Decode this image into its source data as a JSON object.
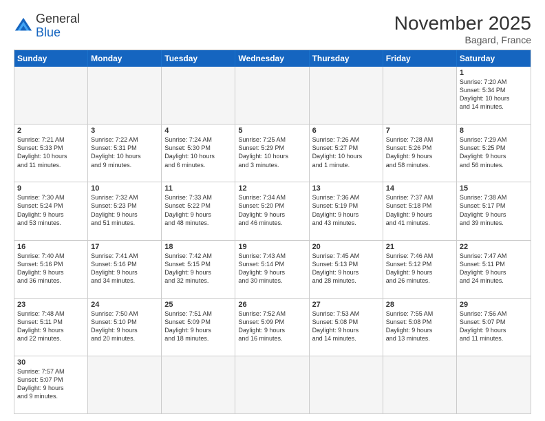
{
  "header": {
    "logo_general": "General",
    "logo_blue": "Blue",
    "month_year": "November 2025",
    "location": "Bagard, France"
  },
  "days": [
    "Sunday",
    "Monday",
    "Tuesday",
    "Wednesday",
    "Thursday",
    "Friday",
    "Saturday"
  ],
  "rows": [
    [
      {
        "day": "",
        "info": "",
        "empty": true
      },
      {
        "day": "",
        "info": "",
        "empty": true
      },
      {
        "day": "",
        "info": "",
        "empty": true
      },
      {
        "day": "",
        "info": "",
        "empty": true
      },
      {
        "day": "",
        "info": "",
        "empty": true
      },
      {
        "day": "",
        "info": "",
        "empty": true
      },
      {
        "day": "1",
        "info": "Sunrise: 7:20 AM\nSunset: 5:34 PM\nDaylight: 10 hours\nand 14 minutes.",
        "empty": false
      }
    ],
    [
      {
        "day": "2",
        "info": "Sunrise: 7:21 AM\nSunset: 5:33 PM\nDaylight: 10 hours\nand 11 minutes.",
        "empty": false
      },
      {
        "day": "3",
        "info": "Sunrise: 7:22 AM\nSunset: 5:31 PM\nDaylight: 10 hours\nand 9 minutes.",
        "empty": false
      },
      {
        "day": "4",
        "info": "Sunrise: 7:24 AM\nSunset: 5:30 PM\nDaylight: 10 hours\nand 6 minutes.",
        "empty": false
      },
      {
        "day": "5",
        "info": "Sunrise: 7:25 AM\nSunset: 5:29 PM\nDaylight: 10 hours\nand 3 minutes.",
        "empty": false
      },
      {
        "day": "6",
        "info": "Sunrise: 7:26 AM\nSunset: 5:27 PM\nDaylight: 10 hours\nand 1 minute.",
        "empty": false
      },
      {
        "day": "7",
        "info": "Sunrise: 7:28 AM\nSunset: 5:26 PM\nDaylight: 9 hours\nand 58 minutes.",
        "empty": false
      },
      {
        "day": "8",
        "info": "Sunrise: 7:29 AM\nSunset: 5:25 PM\nDaylight: 9 hours\nand 56 minutes.",
        "empty": false
      }
    ],
    [
      {
        "day": "9",
        "info": "Sunrise: 7:30 AM\nSunset: 5:24 PM\nDaylight: 9 hours\nand 53 minutes.",
        "empty": false
      },
      {
        "day": "10",
        "info": "Sunrise: 7:32 AM\nSunset: 5:23 PM\nDaylight: 9 hours\nand 51 minutes.",
        "empty": false
      },
      {
        "day": "11",
        "info": "Sunrise: 7:33 AM\nSunset: 5:22 PM\nDaylight: 9 hours\nand 48 minutes.",
        "empty": false
      },
      {
        "day": "12",
        "info": "Sunrise: 7:34 AM\nSunset: 5:20 PM\nDaylight: 9 hours\nand 46 minutes.",
        "empty": false
      },
      {
        "day": "13",
        "info": "Sunrise: 7:36 AM\nSunset: 5:19 PM\nDaylight: 9 hours\nand 43 minutes.",
        "empty": false
      },
      {
        "day": "14",
        "info": "Sunrise: 7:37 AM\nSunset: 5:18 PM\nDaylight: 9 hours\nand 41 minutes.",
        "empty": false
      },
      {
        "day": "15",
        "info": "Sunrise: 7:38 AM\nSunset: 5:17 PM\nDaylight: 9 hours\nand 39 minutes.",
        "empty": false
      }
    ],
    [
      {
        "day": "16",
        "info": "Sunrise: 7:40 AM\nSunset: 5:16 PM\nDaylight: 9 hours\nand 36 minutes.",
        "empty": false
      },
      {
        "day": "17",
        "info": "Sunrise: 7:41 AM\nSunset: 5:16 PM\nDaylight: 9 hours\nand 34 minutes.",
        "empty": false
      },
      {
        "day": "18",
        "info": "Sunrise: 7:42 AM\nSunset: 5:15 PM\nDaylight: 9 hours\nand 32 minutes.",
        "empty": false
      },
      {
        "day": "19",
        "info": "Sunrise: 7:43 AM\nSunset: 5:14 PM\nDaylight: 9 hours\nand 30 minutes.",
        "empty": false
      },
      {
        "day": "20",
        "info": "Sunrise: 7:45 AM\nSunset: 5:13 PM\nDaylight: 9 hours\nand 28 minutes.",
        "empty": false
      },
      {
        "day": "21",
        "info": "Sunrise: 7:46 AM\nSunset: 5:12 PM\nDaylight: 9 hours\nand 26 minutes.",
        "empty": false
      },
      {
        "day": "22",
        "info": "Sunrise: 7:47 AM\nSunset: 5:11 PM\nDaylight: 9 hours\nand 24 minutes.",
        "empty": false
      }
    ],
    [
      {
        "day": "23",
        "info": "Sunrise: 7:48 AM\nSunset: 5:11 PM\nDaylight: 9 hours\nand 22 minutes.",
        "empty": false
      },
      {
        "day": "24",
        "info": "Sunrise: 7:50 AM\nSunset: 5:10 PM\nDaylight: 9 hours\nand 20 minutes.",
        "empty": false
      },
      {
        "day": "25",
        "info": "Sunrise: 7:51 AM\nSunset: 5:09 PM\nDaylight: 9 hours\nand 18 minutes.",
        "empty": false
      },
      {
        "day": "26",
        "info": "Sunrise: 7:52 AM\nSunset: 5:09 PM\nDaylight: 9 hours\nand 16 minutes.",
        "empty": false
      },
      {
        "day": "27",
        "info": "Sunrise: 7:53 AM\nSunset: 5:08 PM\nDaylight: 9 hours\nand 14 minutes.",
        "empty": false
      },
      {
        "day": "28",
        "info": "Sunrise: 7:55 AM\nSunset: 5:08 PM\nDaylight: 9 hours\nand 13 minutes.",
        "empty": false
      },
      {
        "day": "29",
        "info": "Sunrise: 7:56 AM\nSunset: 5:07 PM\nDaylight: 9 hours\nand 11 minutes.",
        "empty": false
      }
    ],
    [
      {
        "day": "30",
        "info": "Sunrise: 7:57 AM\nSunset: 5:07 PM\nDaylight: 9 hours\nand 9 minutes.",
        "empty": false
      },
      {
        "day": "",
        "info": "",
        "empty": true
      },
      {
        "day": "",
        "info": "",
        "empty": true
      },
      {
        "day": "",
        "info": "",
        "empty": true
      },
      {
        "day": "",
        "info": "",
        "empty": true
      },
      {
        "day": "",
        "info": "",
        "empty": true
      },
      {
        "day": "",
        "info": "",
        "empty": true
      }
    ]
  ]
}
